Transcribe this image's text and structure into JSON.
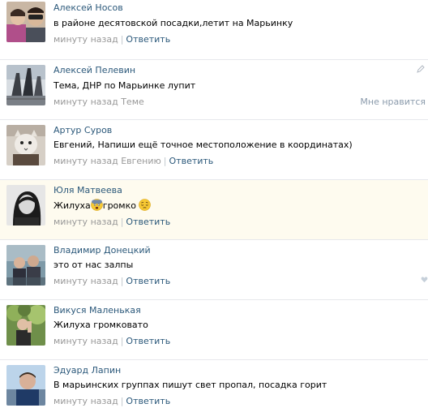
{
  "comments": [
    {
      "author": "Алексей Носов",
      "text": "в районе десятовской посадки,летит на Марьинку",
      "time": "минуту назад",
      "reply_to": "",
      "reply_label": "Ответить"
    },
    {
      "author": "Алексей Пелевин",
      "text": "Тема, ДНР по Марьинке лупит",
      "time": "минуту назад",
      "reply_to": "Теме",
      "like_label": "Мне нравится"
    },
    {
      "author": "Артур Суров",
      "text": "Евгений, Напиши ещё точное местоположение в координатах)",
      "time": "минуту назад",
      "reply_to": "Евгению",
      "reply_label": "Ответить"
    },
    {
      "author": "Юля Матвеева",
      "text_part1": "Жилуха",
      "text_part2": "громко",
      "time": "минуту назад",
      "reply_label": "Ответить",
      "emojis": [
        "fearful-face-icon",
        "pensive-face-icon"
      ]
    },
    {
      "author": "Владимир Донецкий",
      "text": "это от нас залпы",
      "time": "минуту назад",
      "reply_label": "Ответить"
    },
    {
      "author": "Викуся Маленькая",
      "text": "Жилуха громковато",
      "time": "минуту назад",
      "reply_label": "Ответить"
    },
    {
      "author": "Эдуард Лапин",
      "text": "В марьинских группах пишут свет пропал, посадка горит",
      "time": "минуту назад",
      "reply_label": "Ответить"
    }
  ],
  "colors": {
    "link": "#2b587a",
    "meta": "#999999",
    "highlight_bg": "#fefbef",
    "divider": "#e7e8ec"
  }
}
